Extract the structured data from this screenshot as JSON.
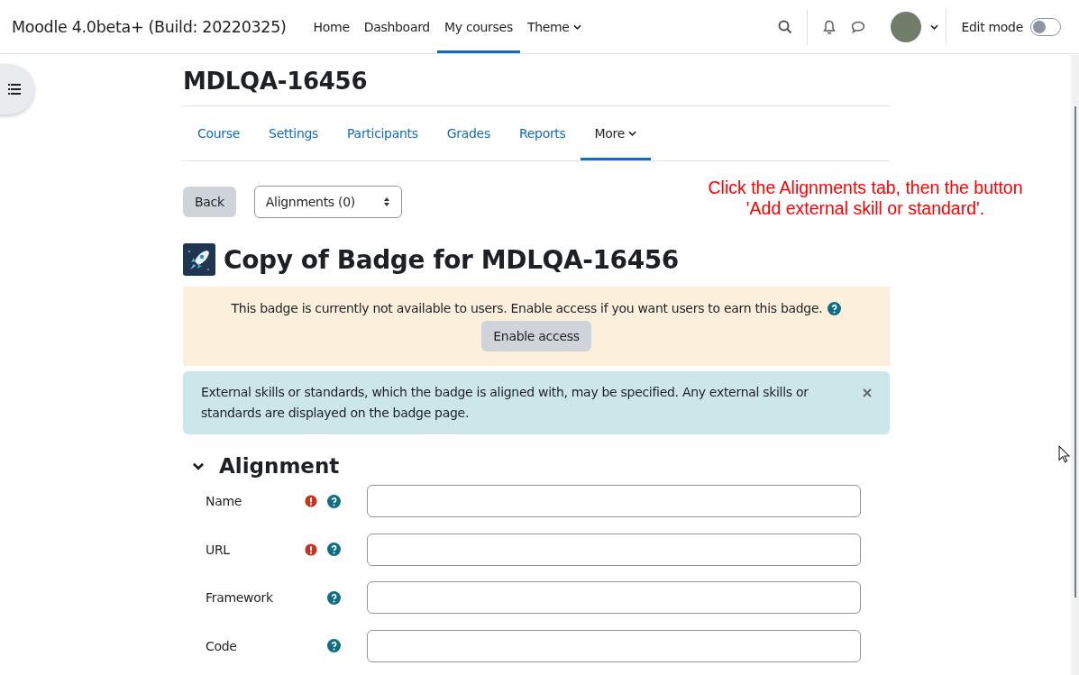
{
  "navbar": {
    "site_name": "Moodle 4.0beta+ (Build: 20220325)",
    "items": [
      {
        "label": "Home",
        "selected": false,
        "dropdown": false
      },
      {
        "label": "Dashboard",
        "selected": false,
        "dropdown": false
      },
      {
        "label": "My courses",
        "selected": true,
        "dropdown": false
      },
      {
        "label": "Theme",
        "selected": false,
        "dropdown": true
      }
    ],
    "edit_mode": {
      "label": "Edit mode",
      "on": false
    }
  },
  "course_title": "MDLQA-16456",
  "course_tabs": [
    {
      "label": "Course",
      "selected": false,
      "dropdown": false
    },
    {
      "label": "Settings",
      "selected": false,
      "dropdown": false
    },
    {
      "label": "Participants",
      "selected": false,
      "dropdown": false
    },
    {
      "label": "Grades",
      "selected": false,
      "dropdown": false
    },
    {
      "label": "Reports",
      "selected": false,
      "dropdown": false
    },
    {
      "label": "More",
      "selected": true,
      "dropdown": true
    }
  ],
  "back_button": "Back",
  "page_select": {
    "value": "Alignments (0)"
  },
  "annotation": "Click the Alignments tab, then the button 'Add external skill or standard'.",
  "badge_title": "Copy of Badge for MDLQA-16456",
  "warning": {
    "text": "This badge is currently not available to users. Enable access if you want users to earn this badge.",
    "button": "Enable access"
  },
  "info": {
    "text": "External skills or standards, which the badge is aligned with, may be specified. Any external skills or standards are displayed on the badge page."
  },
  "section": {
    "title": "Alignment",
    "expanded": true
  },
  "fields": [
    {
      "label": "Name",
      "required": true
    },
    {
      "label": "URL",
      "required": true
    },
    {
      "label": "Framework",
      "required": false
    },
    {
      "label": "Code",
      "required": false
    }
  ]
}
